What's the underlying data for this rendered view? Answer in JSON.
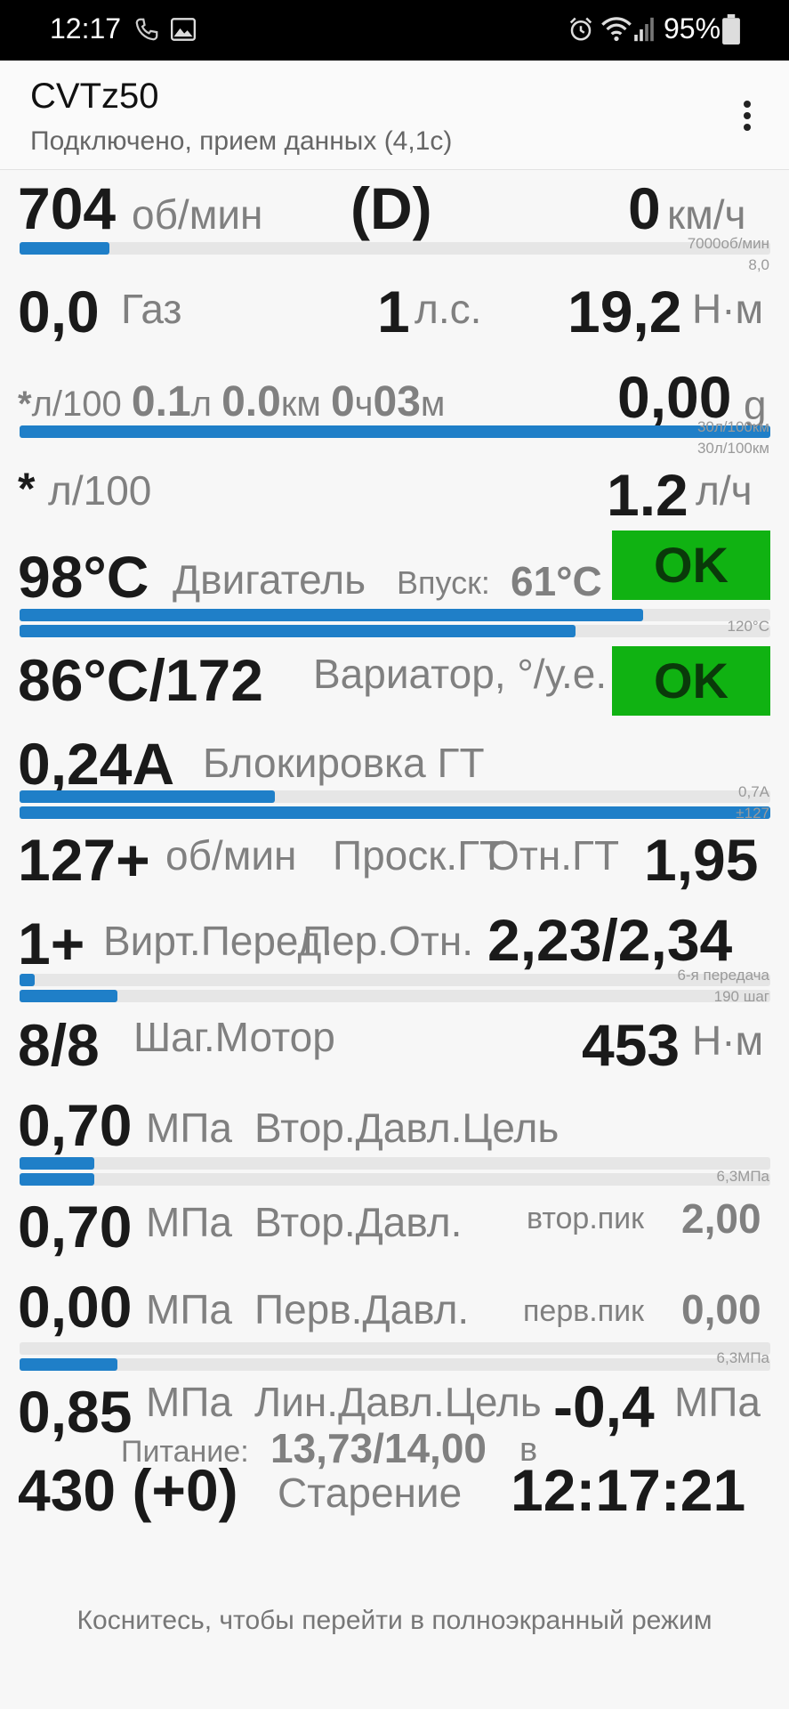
{
  "status_bar": {
    "time": "12:17",
    "battery": "95%"
  },
  "app": {
    "title": "CVTz50",
    "subtitle": "Подключено, прием данных (4,1с)"
  },
  "row_rpm": {
    "value": "704",
    "unit": "об/мин",
    "gear": "(D)",
    "speed": "0",
    "speed_unit": "км/ч",
    "bar_max": "7000об/мин",
    "bar_fill": 0.12,
    "sub_max": "8,0"
  },
  "row_gas": {
    "value": "0,0",
    "label": "Газ",
    "hp": "1",
    "hp_unit": "л.с.",
    "torque": "19,2",
    "torque_unit": "Н·м"
  },
  "row_trip": {
    "a": "*",
    "a_unit": "л/100",
    "b": "0.1",
    "b_unit": "л",
    "c": "0.0",
    "c_unit": "км",
    "d": "0",
    "d_unit": "ч",
    "e": "03",
    "e_unit": "м",
    "g": "0,00",
    "g_unit": "g",
    "bar_max1": "30л/100км",
    "bar_max2": "30л/100км",
    "bar_fill": 1.0
  },
  "row_cons": {
    "value": "*",
    "unit": "л/100",
    "rate": "1.2",
    "rate_unit": "л/ч"
  },
  "row_engine": {
    "temp": "98°C",
    "label": "Двигатель",
    "intake_label": "Впуск:",
    "intake": "61°C",
    "status": "OK",
    "bar_max": "120°C",
    "bar_fill1": 0.83,
    "bar_fill2": 0.74
  },
  "row_cvt": {
    "temp": "86°C/172",
    "label": "Вариатор, °/у.е.",
    "status": "OK"
  },
  "row_lock": {
    "value": "0,24A",
    "label": "Блокировка ГТ",
    "bar_max1": "0,7A",
    "bar_max2": "±127",
    "bar_fill1": 0.34,
    "bar_fill2": 1.0
  },
  "row_slip": {
    "value": "127+",
    "unit": "об/мин",
    "label": "Проск.ГТ",
    "ratio_label": "Отн.ГТ",
    "ratio": "1,95"
  },
  "row_gear": {
    "value": "1+",
    "label": "Вирт.Перед.",
    "ratio_label": "Пер.Отн.",
    "ratio": "2,23/2,34",
    "bar_max1": "6-я передача",
    "bar_max2": "190 шаг",
    "bar_fill1": 0.02,
    "bar_fill2": 0.13
  },
  "row_step": {
    "value": "8/8",
    "label": "Шаг.Мотор",
    "torque": "453",
    "torque_unit": "Н·м"
  },
  "row_sec_target": {
    "value": "0,70",
    "unit": "МПа",
    "label": "Втор.Давл.Цель",
    "bar_max": "6,3МПа",
    "bar_fill1": 0.1,
    "bar_fill2": 0.1
  },
  "row_sec": {
    "value": "0,70",
    "unit": "МПа",
    "label": "Втор.Давл.",
    "peak_label": "втор.пик",
    "peak": "2,00"
  },
  "row_prim": {
    "value": "0,00",
    "unit": "МПа",
    "label": "Перв.Давл.",
    "peak_label": "перв.пик",
    "peak": "0,00",
    "bar_max": "6,3МПа",
    "bar_fill": 0.13
  },
  "row_line": {
    "value": "0,85",
    "unit": "МПа",
    "label": "Лин.Давл.Цель",
    "right": "-0,4",
    "right_unit": "МПа",
    "power_label": "Питание:",
    "power": "13,73/14,00",
    "power_unit": "в"
  },
  "row_age": {
    "value": "430 (+0)",
    "label": "Старение",
    "clock": "12:17:21"
  },
  "footer": {
    "hint": "Коснитесь, чтобы перейти в полноэкранный режим"
  }
}
